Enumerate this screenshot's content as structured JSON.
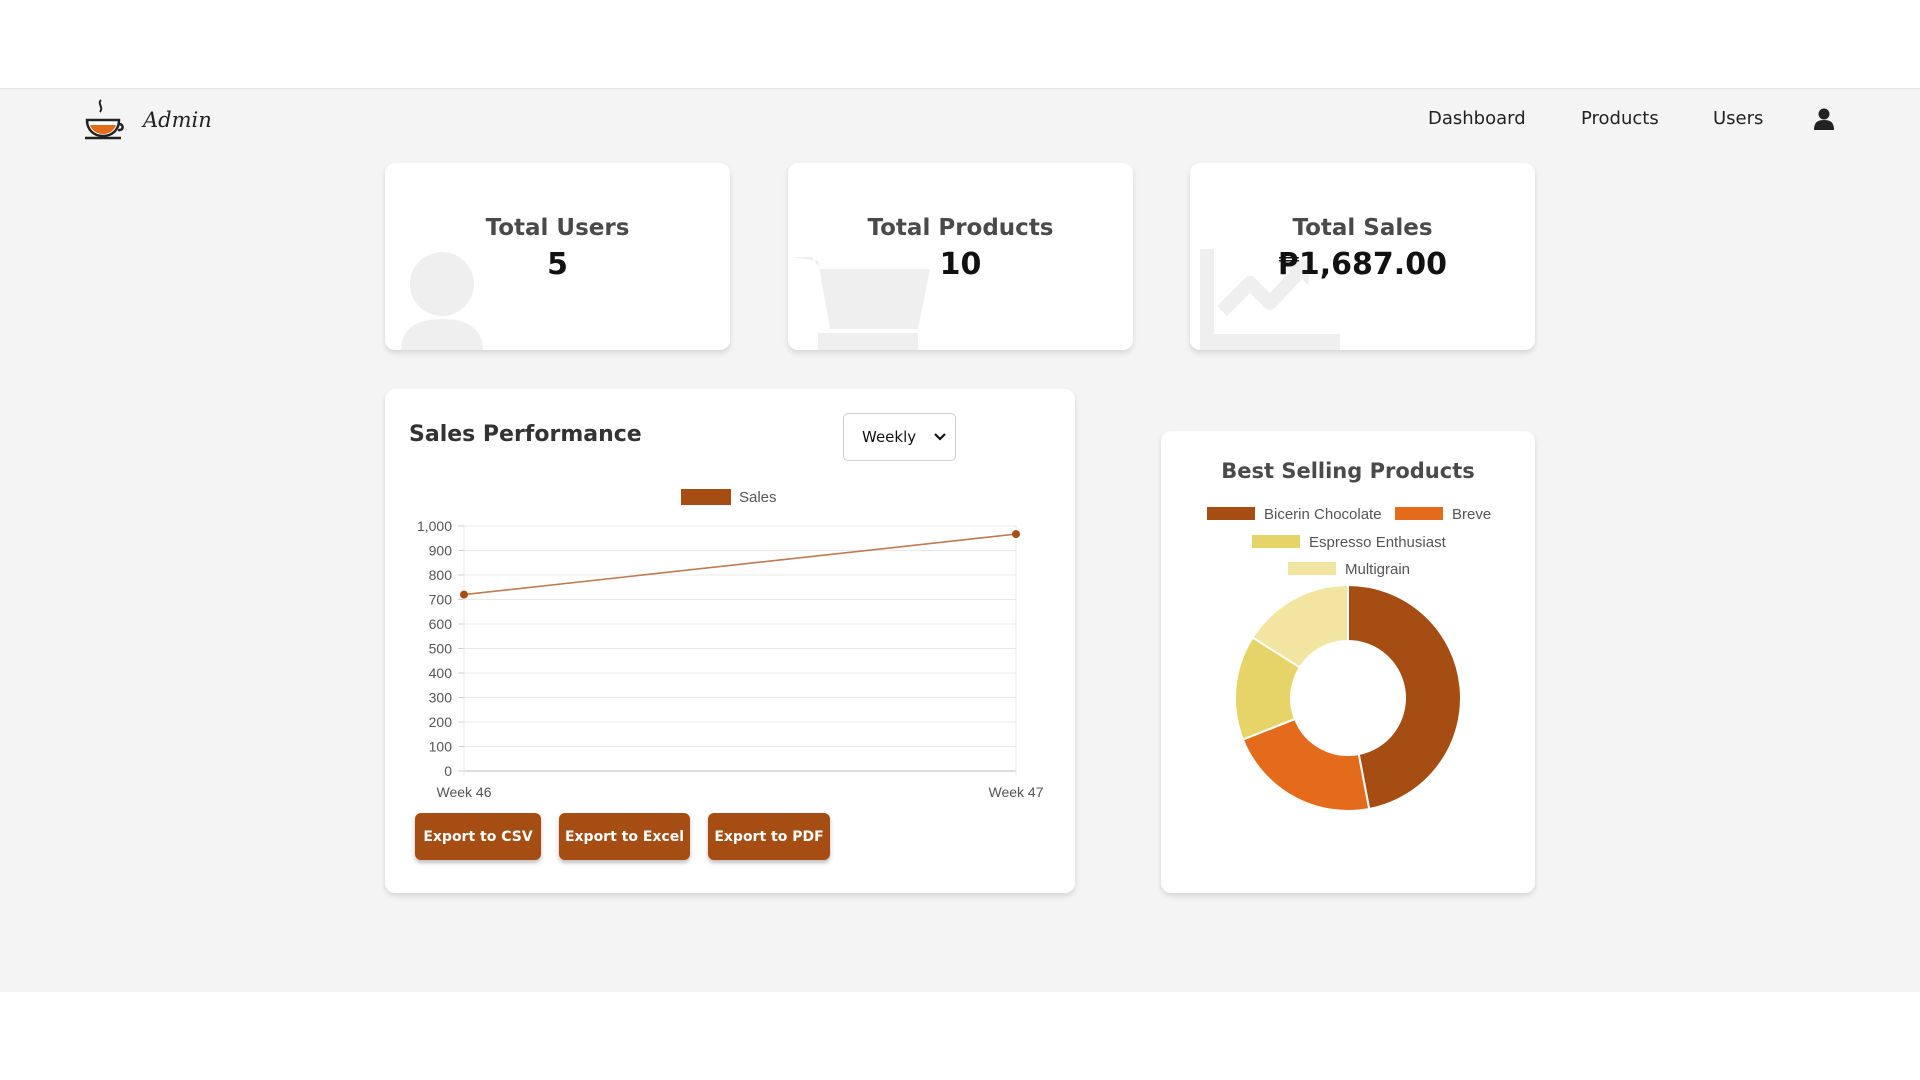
{
  "navbar": {
    "brand": "Admin",
    "links": [
      "Dashboard",
      "Products",
      "Users"
    ]
  },
  "stats": [
    {
      "label": "Total Users",
      "value": "5",
      "icon": "user-icon"
    },
    {
      "label": "Total Products",
      "value": "10",
      "icon": "cart-icon"
    },
    {
      "label": "Total Sales",
      "value": "₱1,687.00",
      "icon": "trend-chart-icon"
    }
  ],
  "sales": {
    "title": "Sales Performance",
    "period": "Weekly",
    "buttons": [
      "Export to CSV",
      "Export to Excel",
      "Export to PDF"
    ],
    "colors": {
      "accent": "#a64d14"
    }
  },
  "best": {
    "title": "Best Selling Products"
  },
  "chart_data": [
    {
      "type": "line",
      "x": [
        "Week 46",
        "Week 47"
      ],
      "series": [
        {
          "name": "Sales",
          "values": [
            720,
            967
          ],
          "color": "#a64d14"
        }
      ],
      "yticks": [
        "0",
        "100",
        "200",
        "300",
        "400",
        "500",
        "600",
        "700",
        "800",
        "900",
        "1,000"
      ],
      "ylim": [
        0,
        1000
      ],
      "legend": "top",
      "grid": true
    },
    {
      "type": "pie",
      "donut": true,
      "labels": [
        "Bicerin Chocolate",
        "Breve",
        "Espresso Enthusiast",
        "Multigrain"
      ],
      "values": [
        47,
        22,
        15,
        16
      ],
      "colors": [
        "#a64d14",
        "#e46a1c",
        "#e6d468",
        "#f2e5a2"
      ],
      "legend": "top"
    }
  ]
}
